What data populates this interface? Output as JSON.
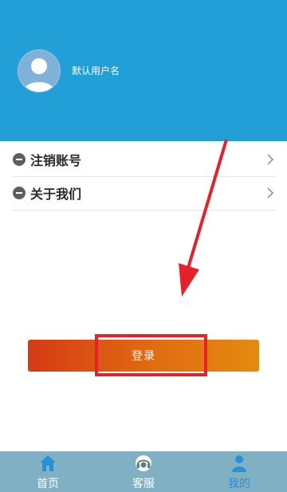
{
  "profile": {
    "username": "默认用户名"
  },
  "menu": {
    "items": [
      {
        "label": "注销账号"
      },
      {
        "label": "关于我们"
      }
    ]
  },
  "login": {
    "label": "登录"
  },
  "tabbar": {
    "tabs": [
      {
        "label": "首页",
        "icon": "home-icon"
      },
      {
        "label": "客服",
        "icon": "headset-icon"
      },
      {
        "label": "我的",
        "icon": "user-icon",
        "active": true
      }
    ]
  },
  "colors": {
    "header": "#229fd6",
    "tabbar": "#7fb0c4",
    "active_tab": "#2b8fd8",
    "button_start": "#d53a15",
    "button_end": "#e48a10",
    "annotation": "#e8202c"
  }
}
